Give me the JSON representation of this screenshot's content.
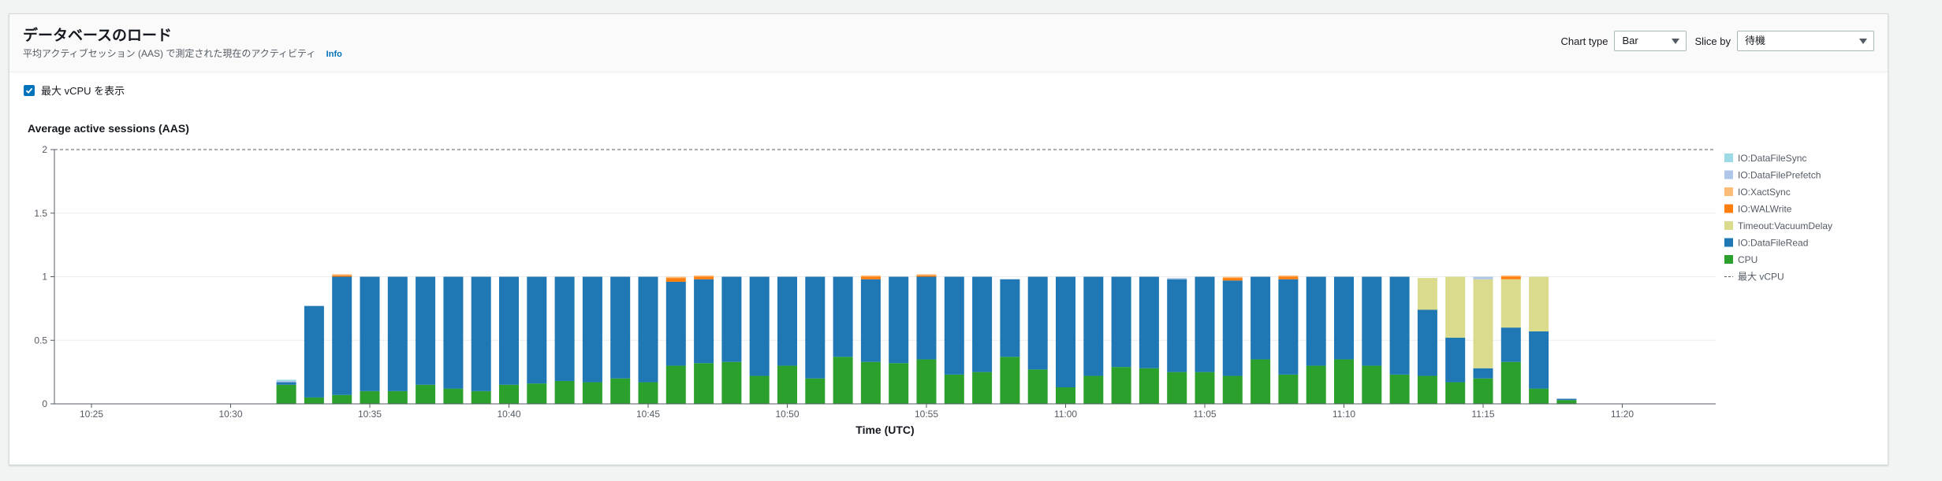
{
  "header": {
    "title": "データベースのロード",
    "subtitle": "平均アクティブセッション (AAS) で測定された現在のアクティビティ",
    "info_link": "Info"
  },
  "controls": {
    "chart_type_label": "Chart type",
    "chart_type_value": "Bar",
    "slice_by_label": "Slice by",
    "slice_by_value": "待機"
  },
  "vcpu_toggle": {
    "label": "最大 vCPU を表示",
    "checked": true
  },
  "chart_data": {
    "type": "bar",
    "stacked": true,
    "title": "Average active sessions (AAS)",
    "xlabel": "Time (UTC)",
    "ylabel": "",
    "ylim": [
      0,
      2
    ],
    "yticks": [
      {
        "value": 0,
        "label": "0"
      },
      {
        "value": 0.5,
        "label": "0.5"
      },
      {
        "value": 1,
        "label": "1"
      },
      {
        "value": 1.5,
        "label": "1.5"
      },
      {
        "value": 2,
        "label": "2"
      }
    ],
    "xticks": [
      "10:25",
      "10:30",
      "10:35",
      "10:40",
      "10:45",
      "10:50",
      "10:55",
      "11:00",
      "11:05",
      "11:10",
      "11:15",
      "11:20"
    ],
    "grid": true,
    "legend_position": "right",
    "max_vcpu": 2,
    "categories": [
      "10:32",
      "10:33",
      "10:34",
      "10:35",
      "10:36",
      "10:37",
      "10:38",
      "10:39",
      "10:40",
      "10:41",
      "10:42",
      "10:43",
      "10:44",
      "10:45",
      "10:46",
      "10:47",
      "10:48",
      "10:49",
      "10:50",
      "10:51",
      "10:52",
      "10:53",
      "10:54",
      "10:55",
      "10:56",
      "10:57",
      "10:58",
      "10:59",
      "11:00",
      "11:01",
      "11:02",
      "11:03",
      "11:04",
      "11:05",
      "11:06",
      "11:07",
      "11:08",
      "11:09",
      "11:10",
      "11:11",
      "11:12",
      "11:13",
      "11:14",
      "11:15",
      "11:16",
      "11:17",
      "11:18"
    ],
    "series": [
      {
        "name": "CPU",
        "color": "#2ca02c",
        "values": [
          0.15,
          0.05,
          0.07,
          0.1,
          0.1,
          0.15,
          0.12,
          0.1,
          0.15,
          0.16,
          0.18,
          0.17,
          0.2,
          0.17,
          0.3,
          0.32,
          0.33,
          0.22,
          0.3,
          0.2,
          0.37,
          0.33,
          0.32,
          0.35,
          0.23,
          0.25,
          0.37,
          0.27,
          0.13,
          0.22,
          0.29,
          0.28,
          0.25,
          0.25,
          0.22,
          0.35,
          0.23,
          0.3,
          0.35,
          0.3,
          0.23,
          0.22,
          0.17,
          0.2,
          0.33,
          0.12,
          0.03
        ]
      },
      {
        "name": "IO:DataFileRead",
        "color": "#1f77b4",
        "values": [
          0.02,
          0.72,
          0.93,
          0.9,
          0.9,
          0.85,
          0.88,
          0.9,
          0.85,
          0.84,
          0.82,
          0.83,
          0.8,
          0.83,
          0.66,
          0.66,
          0.67,
          0.78,
          0.7,
          0.8,
          0.63,
          0.65,
          0.68,
          0.65,
          0.77,
          0.75,
          0.61,
          0.73,
          0.87,
          0.78,
          0.71,
          0.72,
          0.73,
          0.75,
          0.75,
          0.65,
          0.75,
          0.7,
          0.65,
          0.7,
          0.77,
          0.52,
          0.35,
          0.08,
          0.27,
          0.45,
          0.01
        ]
      },
      {
        "name": "Timeout:VacuumDelay",
        "color": "#dbdb8d",
        "values": [
          0,
          0,
          0,
          0,
          0,
          0,
          0,
          0,
          0,
          0,
          0,
          0,
          0,
          0,
          0,
          0,
          0,
          0,
          0,
          0,
          0,
          0,
          0,
          0,
          0,
          0,
          0,
          0,
          0,
          0,
          0,
          0,
          0,
          0,
          0,
          0,
          0,
          0,
          0,
          0,
          0,
          0.25,
          0.48,
          0.7,
          0.38,
          0.43,
          0
        ]
      },
      {
        "name": "IO:WALWrite",
        "color": "#ff7f0e",
        "values": [
          0,
          0,
          0.01,
          0,
          0,
          0,
          0,
          0,
          0,
          0,
          0,
          0,
          0,
          0,
          0.03,
          0.02,
          0,
          0,
          0,
          0,
          0,
          0.02,
          0,
          0.01,
          0,
          0,
          0,
          0,
          0,
          0,
          0,
          0,
          0,
          0,
          0.02,
          0,
          0.02,
          0,
          0,
          0,
          0,
          0,
          0,
          0,
          0.02,
          0,
          0
        ]
      },
      {
        "name": "IO:XactSync",
        "color": "#ffbb78",
        "values": [
          0,
          0,
          0.01,
          0,
          0,
          0,
          0,
          0,
          0,
          0,
          0,
          0,
          0,
          0,
          0.01,
          0.01,
          0,
          0,
          0,
          0,
          0,
          0.01,
          0,
          0.01,
          0,
          0,
          0,
          0,
          0,
          0,
          0,
          0,
          0,
          0,
          0.01,
          0,
          0.01,
          0,
          0,
          0,
          0,
          0,
          0,
          0,
          0.01,
          0,
          0
        ]
      },
      {
        "name": "IO:DataFilePrefetch",
        "color": "#aec7e8",
        "values": [
          0.01,
          0,
          0,
          0,
          0,
          0,
          0,
          0,
          0,
          0,
          0,
          0,
          0,
          0,
          0,
          0,
          0,
          0,
          0,
          0,
          0,
          0,
          0,
          0,
          0,
          0,
          0,
          0,
          0,
          0,
          0,
          0,
          0.01,
          0,
          0,
          0,
          0,
          0,
          0,
          0,
          0,
          0,
          0,
          0.02,
          0,
          0,
          0
        ]
      },
      {
        "name": "IO:DataFileSync",
        "color": "#9edae5",
        "values": [
          0.01,
          0,
          0,
          0,
          0,
          0,
          0,
          0,
          0,
          0,
          0,
          0,
          0,
          0,
          0,
          0,
          0,
          0,
          0,
          0,
          0,
          0,
          0,
          0,
          0,
          0,
          0,
          0,
          0,
          0,
          0,
          0,
          0,
          0,
          0,
          0,
          0,
          0,
          0,
          0,
          0,
          0,
          0,
          0,
          0,
          0,
          0
        ]
      }
    ],
    "legend": [
      {
        "name": "IO:DataFileSync",
        "color": "#9edae5"
      },
      {
        "name": "IO:DataFilePrefetch",
        "color": "#aec7e8"
      },
      {
        "name": "IO:XactSync",
        "color": "#ffbb78"
      },
      {
        "name": "IO:WALWrite",
        "color": "#ff7f0e"
      },
      {
        "name": "Timeout:VacuumDelay",
        "color": "#dbdb8d"
      },
      {
        "name": "IO:DataFileRead",
        "color": "#1f77b4"
      },
      {
        "name": "CPU",
        "color": "#2ca02c"
      }
    ],
    "max_vcpu_legend": "最大 vCPU"
  }
}
